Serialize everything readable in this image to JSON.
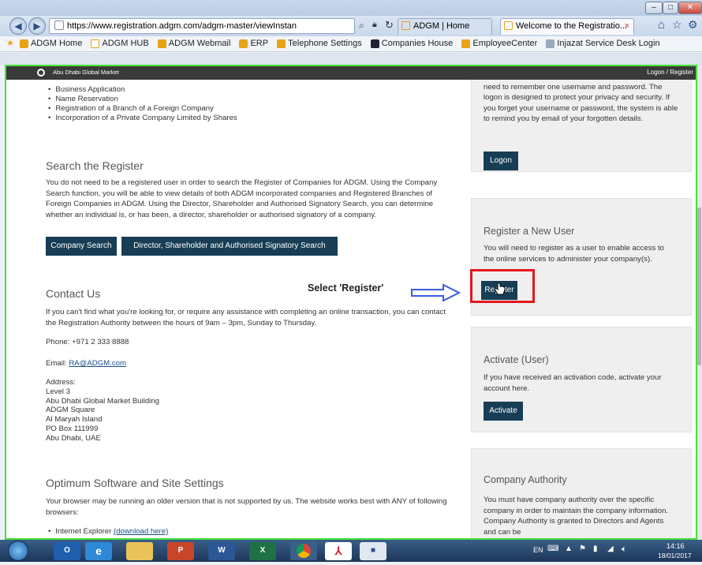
{
  "browser": {
    "url": "https://www.registration.adgm.com/adgm-master/viewInstan",
    "tabs": [
      {
        "label": "ADGM | Home"
      },
      {
        "label": "Welcome to the Registratio...",
        "close": "×"
      }
    ],
    "favorites": [
      "ADGM Home",
      "ADGM HUB",
      "ADGM Webmail",
      "ERP",
      "Telephone Settings",
      "Companies House",
      "EmployeeCenter",
      "Injazat Service Desk Login"
    ]
  },
  "site": {
    "logo_text": "Abu Dhabi Global Market",
    "logon_register": "Logon / Register"
  },
  "left": {
    "bullets": [
      "Business Application",
      "Name Reservation",
      "Registration of a Branch of a Foreign Company",
      "Incorporation of a Private Company Limited by Shares"
    ],
    "search_title": "Search the Register",
    "search_text": "You do not need to be a registered user in order to search the Register of Companies for ADGM. Using the Company Search function, you will be able to view details of both ADGM incorporated companies and Registered Branches of Foreign Companies in ADGM. Using the Director, Shareholder and Authorised Signatory Search, you can determine whether an individual is, or has been, a director, shareholder or authorised signatory of a company.",
    "btn_company_search": "Company Search",
    "btn_director_search": "Director, Shareholder and Authorised Signatory Search",
    "contact_title": "Contact Us",
    "contact_text": "If you can't find what you're looking for, or require any assistance with completing an online transaction, you can contact the Registration Authority between the hours of 9am – 3pm, Sunday to Thursday.",
    "phone": "Phone: +971 2 333 8888",
    "email_label": "Email: ",
    "email_link": "RA@ADGM.com",
    "address_lines": [
      "Address:",
      "Level 3",
      "Abu Dhabi Global Market Building",
      "ADGM Square",
      "Al Maryah Island",
      "PO Box 111999",
      "Abu Dhabi, UAE"
    ],
    "optimum_title": "Optimum Software and Site Settings",
    "optimum_text": "Your browser may be running an older version that is not supported by us. The website works best with ANY of following browsers:",
    "browser_item": "Internet Explorer ",
    "browser_link": "(download here)"
  },
  "right": {
    "logon_text": "A logon is used to access many online services - you only need to remember one username and password. The logon is designed to protect your privacy and security. If you forget your username or password, the system is able to remind you by email of your forgotten details.",
    "logon_btn": "Logon",
    "register_title": "Register a New User",
    "register_text": "You will need to register as a user to enable access to the online services to administer your company(s).",
    "register_btn": "Register",
    "activate_title": "Activate (User)",
    "activate_text": "If you have received an activation code, activate your account here.",
    "activate_btn": "Activate",
    "authority_title": "Company Authority",
    "authority_text": "You must have company authority over the specific company in order to maintain the company information. Company Authority is granted to Directors and Agents and can be"
  },
  "annotation": {
    "text": "Select 'Register'",
    "highlight_color": "#e3161f",
    "arrow_color": "#3b5bdb"
  },
  "taskbar": {
    "lang": "EN",
    "time": "14:16",
    "date": "18/01/2017",
    "apps": [
      "outlook-icon",
      "ie-icon",
      "explorer-icon",
      "powerpoint-icon",
      "word-icon",
      "excel-icon",
      "chrome-icon",
      "acrobat-icon",
      "media-icon"
    ]
  },
  "colors": {
    "button_bg": "#173e55",
    "frame_green": "#46e23a",
    "panel_bg": "#efefef"
  }
}
